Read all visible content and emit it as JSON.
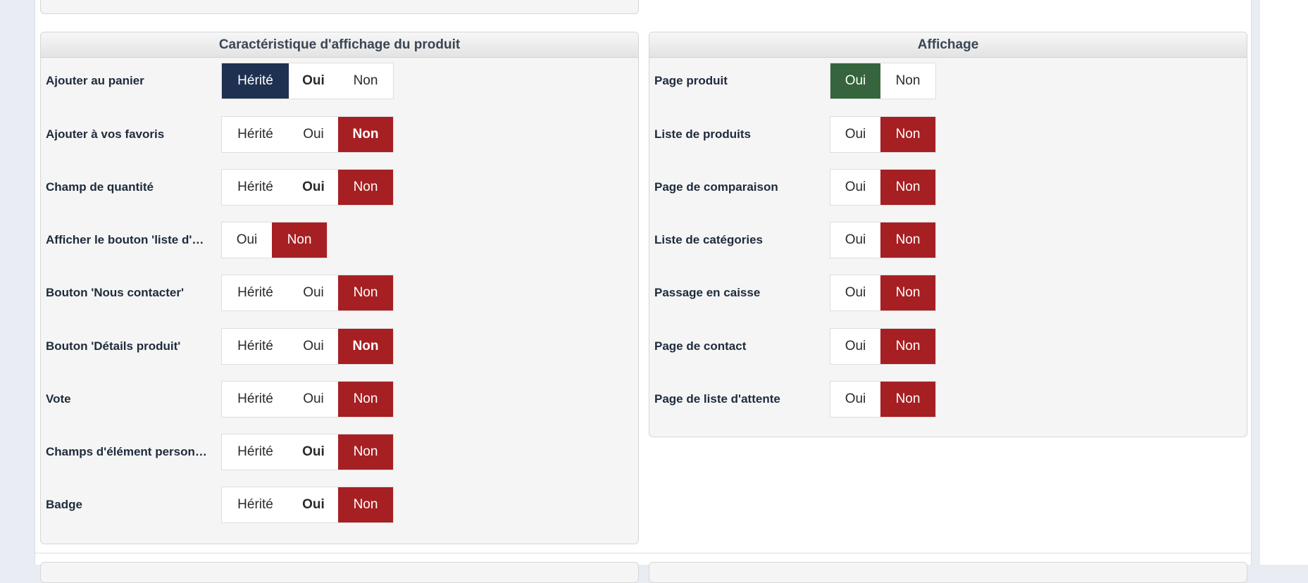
{
  "panel_left": {
    "title": "Caractéristique d'affichage du produit",
    "rows": [
      {
        "label": "Ajouter au panier",
        "options": [
          "Hérité",
          "Oui",
          "Non"
        ]
      },
      {
        "label": "Ajouter à vos favoris",
        "options": [
          "Hérité",
          "Oui",
          "Non"
        ]
      },
      {
        "label": "Champ de quantité",
        "options": [
          "Hérité",
          "Oui",
          "Non"
        ]
      },
      {
        "label": "Afficher le bouton 'liste d'at...",
        "options": [
          "Oui",
          "Non"
        ]
      },
      {
        "label": "Bouton 'Nous contacter'",
        "options": [
          "Hérité",
          "Oui",
          "Non"
        ]
      },
      {
        "label": "Bouton 'Détails produit'",
        "options": [
          "Hérité",
          "Oui",
          "Non"
        ]
      },
      {
        "label": "Vote",
        "options": [
          "Hérité",
          "Oui",
          "Non"
        ]
      },
      {
        "label": "Champs d'élément personn...",
        "options": [
          "Hérité",
          "Oui",
          "Non"
        ]
      },
      {
        "label": "Badge",
        "options": [
          "Hérité",
          "Oui",
          "Non"
        ]
      }
    ]
  },
  "panel_right": {
    "title": "Affichage",
    "rows": [
      {
        "label": "Page produit",
        "options": [
          "Oui",
          "Non"
        ]
      },
      {
        "label": "Liste de produits",
        "options": [
          "Oui",
          "Non"
        ]
      },
      {
        "label": "Page de comparaison",
        "options": [
          "Oui",
          "Non"
        ]
      },
      {
        "label": "Liste de catégories",
        "options": [
          "Oui",
          "Non"
        ]
      },
      {
        "label": "Passage en caisse",
        "options": [
          "Oui",
          "Non"
        ]
      },
      {
        "label": "Page de contact",
        "options": [
          "Oui",
          "Non"
        ]
      },
      {
        "label": "Page de liste d'attente",
        "options": [
          "Oui",
          "Non"
        ]
      }
    ]
  },
  "colors": {
    "inherited_active": "#1e3150",
    "no_active": "#a61f22",
    "yes_active": "#35643d"
  }
}
